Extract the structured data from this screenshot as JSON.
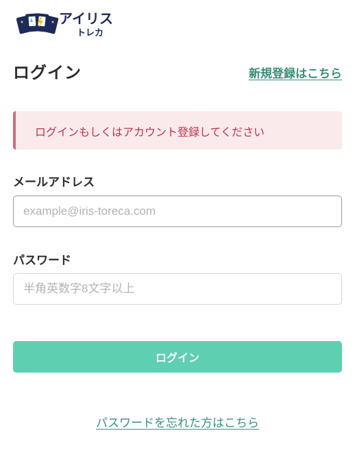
{
  "logo": {
    "name_main": "アイリス",
    "name_sub": "トレカ"
  },
  "header": {
    "title": "ログイン",
    "register_link": "新規登録はこちら"
  },
  "alert": {
    "message": "ログインもしくはアカウント登録してください",
    "color": "#c0334a",
    "background": "#fbeaec"
  },
  "form": {
    "email_label": "メールアドレス",
    "email_placeholder": "example@iris-toreca.com",
    "email_value": "",
    "password_label": "パスワード",
    "password_placeholder": "半角英数字8文字以上",
    "password_value": "",
    "submit_label": "ログイン"
  },
  "footer": {
    "forgot_password_link": "パスワードを忘れた方はこちら"
  },
  "colors": {
    "accent": "#5fcfb1",
    "link": "#3b8f79"
  }
}
